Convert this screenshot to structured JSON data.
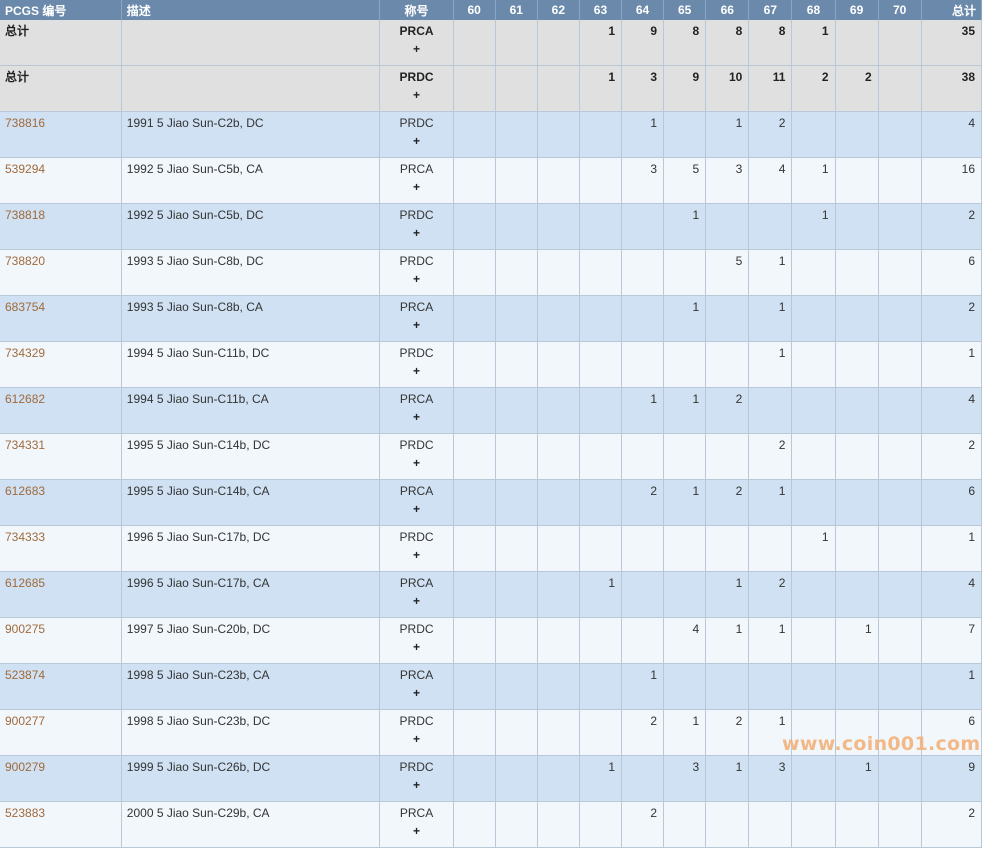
{
  "header": {
    "pcgs": "PCGS 编号",
    "desc": "描述",
    "designation": "称号",
    "grades": [
      "60",
      "61",
      "62",
      "63",
      "64",
      "65",
      "66",
      "67",
      "68",
      "69",
      "70"
    ],
    "total": "总计"
  },
  "totals": [
    {
      "label": "总计",
      "designation": "PRCA",
      "plus": "+",
      "counts": [
        "",
        "",
        "",
        "1",
        "9",
        "8",
        "8",
        "8",
        "1",
        "",
        ""
      ],
      "total": "35"
    },
    {
      "label": "总计",
      "designation": "PRDC",
      "plus": "+",
      "counts": [
        "",
        "",
        "",
        "1",
        "3",
        "9",
        "10",
        "11",
        "2",
        "2",
        ""
      ],
      "total": "38"
    }
  ],
  "rows": [
    {
      "pcgs": "738816",
      "desc": "1991 5 Jiao Sun-C2b, DC",
      "designation": "PRDC",
      "plus": "+",
      "counts": [
        "",
        "",
        "",
        "",
        "1",
        "",
        "1",
        "2",
        "",
        "",
        ""
      ],
      "total": "4"
    },
    {
      "pcgs": "539294",
      "desc": "1992 5 Jiao Sun-C5b, CA",
      "designation": "PRCA",
      "plus": "+",
      "counts": [
        "",
        "",
        "",
        "",
        "3",
        "5",
        "3",
        "4",
        "1",
        "",
        ""
      ],
      "total": "16"
    },
    {
      "pcgs": "738818",
      "desc": "1992 5 Jiao Sun-C5b, DC",
      "designation": "PRDC",
      "plus": "+",
      "counts": [
        "",
        "",
        "",
        "",
        "",
        "1",
        "",
        "",
        "1",
        "",
        ""
      ],
      "total": "2"
    },
    {
      "pcgs": "738820",
      "desc": "1993 5 Jiao Sun-C8b, DC",
      "designation": "PRDC",
      "plus": "+",
      "counts": [
        "",
        "",
        "",
        "",
        "",
        "",
        "5",
        "1",
        "",
        "",
        ""
      ],
      "total": "6"
    },
    {
      "pcgs": "683754",
      "desc": "1993 5 Jiao Sun-C8b, CA",
      "designation": "PRCA",
      "plus": "+",
      "counts": [
        "",
        "",
        "",
        "",
        "",
        "1",
        "",
        "1",
        "",
        "",
        ""
      ],
      "total": "2"
    },
    {
      "pcgs": "734329",
      "desc": "1994 5 Jiao Sun-C11b, DC",
      "designation": "PRDC",
      "plus": "+",
      "counts": [
        "",
        "",
        "",
        "",
        "",
        "",
        "",
        "1",
        "",
        "",
        ""
      ],
      "total": "1"
    },
    {
      "pcgs": "612682",
      "desc": "1994 5 Jiao Sun-C11b, CA",
      "designation": "PRCA",
      "plus": "+",
      "counts": [
        "",
        "",
        "",
        "",
        "1",
        "1",
        "2",
        "",
        "",
        "",
        ""
      ],
      "total": "4"
    },
    {
      "pcgs": "734331",
      "desc": "1995 5 Jiao Sun-C14b, DC",
      "designation": "PRDC",
      "plus": "+",
      "counts": [
        "",
        "",
        "",
        "",
        "",
        "",
        "",
        "2",
        "",
        "",
        ""
      ],
      "total": "2"
    },
    {
      "pcgs": "612683",
      "desc": "1995 5 Jiao Sun-C14b, CA",
      "designation": "PRCA",
      "plus": "+",
      "counts": [
        "",
        "",
        "",
        "",
        "2",
        "1",
        "2",
        "1",
        "",
        "",
        ""
      ],
      "total": "6"
    },
    {
      "pcgs": "734333",
      "desc": "1996 5 Jiao Sun-C17b, DC",
      "designation": "PRDC",
      "plus": "+",
      "counts": [
        "",
        "",
        "",
        "",
        "",
        "",
        "",
        "",
        "1",
        "",
        ""
      ],
      "total": "1"
    },
    {
      "pcgs": "612685",
      "desc": "1996 5 Jiao Sun-C17b, CA",
      "designation": "PRCA",
      "plus": "+",
      "counts": [
        "",
        "",
        "",
        "1",
        "",
        "",
        "1",
        "2",
        "",
        "",
        ""
      ],
      "total": "4"
    },
    {
      "pcgs": "900275",
      "desc": "1997 5 Jiao Sun-C20b, DC",
      "designation": "PRDC",
      "plus": "+",
      "counts": [
        "",
        "",
        "",
        "",
        "",
        "4",
        "1",
        "1",
        "",
        "1",
        ""
      ],
      "total": "7"
    },
    {
      "pcgs": "523874",
      "desc": "1998 5 Jiao Sun-C23b, CA",
      "designation": "PRCA",
      "plus": "+",
      "counts": [
        "",
        "",
        "",
        "",
        "1",
        "",
        "",
        "",
        "",
        "",
        ""
      ],
      "total": "1"
    },
    {
      "pcgs": "900277",
      "desc": "1998 5 Jiao Sun-C23b, DC",
      "designation": "PRDC",
      "plus": "+",
      "counts": [
        "",
        "",
        "",
        "",
        "2",
        "1",
        "2",
        "1",
        "",
        "",
        ""
      ],
      "total": "6"
    },
    {
      "pcgs": "900279",
      "desc": "1999 5 Jiao Sun-C26b, DC",
      "designation": "PRDC",
      "plus": "+",
      "counts": [
        "",
        "",
        "",
        "1",
        "",
        "3",
        "1",
        "3",
        "",
        "1",
        ""
      ],
      "total": "9"
    },
    {
      "pcgs": "523883",
      "desc": "2000 5 Jiao Sun-C29b, CA",
      "designation": "PRCA",
      "plus": "+",
      "counts": [
        "",
        "",
        "",
        "",
        "2",
        "",
        "",
        "",
        "",
        "",
        ""
      ],
      "total": "2"
    }
  ],
  "watermark": "www.coin001.com"
}
